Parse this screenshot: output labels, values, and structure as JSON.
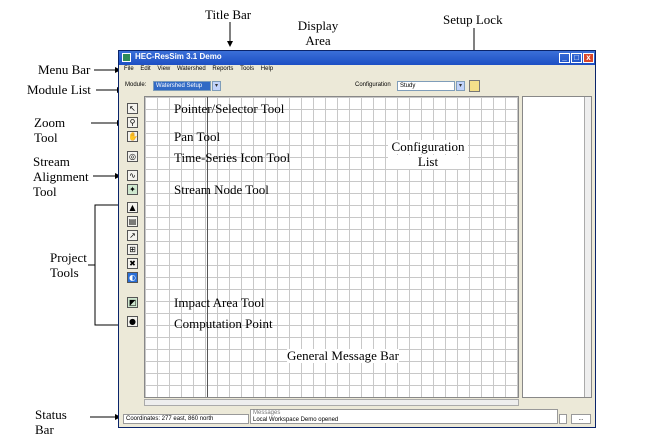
{
  "labels": {
    "title_bar": "Title Bar",
    "display_area_1": "Display",
    "display_area_2": "Area",
    "setup_lock": "Setup Lock",
    "menu_bar": "Menu Bar",
    "module_list": "Module List",
    "zoom_tool_1": "Zoom",
    "zoom_tool_2": "Tool",
    "stream_alignment_1": "Stream",
    "stream_alignment_2": "Alignment",
    "stream_alignment_3": "Tool",
    "project_tools_1": "Project",
    "project_tools_2": "Tools",
    "status_bar_1": "Status",
    "status_bar_2": "Bar",
    "pointer_selector": "Pointer/Selector Tool",
    "pan_tool": "Pan Tool",
    "time_series": "Time-Series Icon Tool",
    "stream_node": "Stream Node Tool",
    "impact_area": "Impact Area Tool",
    "computation_point": "Computation Point",
    "configuration_list_1": "Configuration",
    "configuration_list_2": "List",
    "general_message_bar": "General Message Bar"
  },
  "window": {
    "title": "HEC-ResSim 3.1    Demo",
    "menu": [
      "File",
      "Edit",
      "View",
      "Watershed",
      "Reports",
      "Tools",
      "Help"
    ],
    "module_label": "Module:",
    "module_value": "Watershed Setup",
    "configuration_label": "Configuration",
    "configuration_value": "Study",
    "status_coords": "Coordinates: 277 east, 860 north",
    "message_top": "Messages",
    "message": "Local Workspace Demo opened",
    "status_button": "..."
  }
}
